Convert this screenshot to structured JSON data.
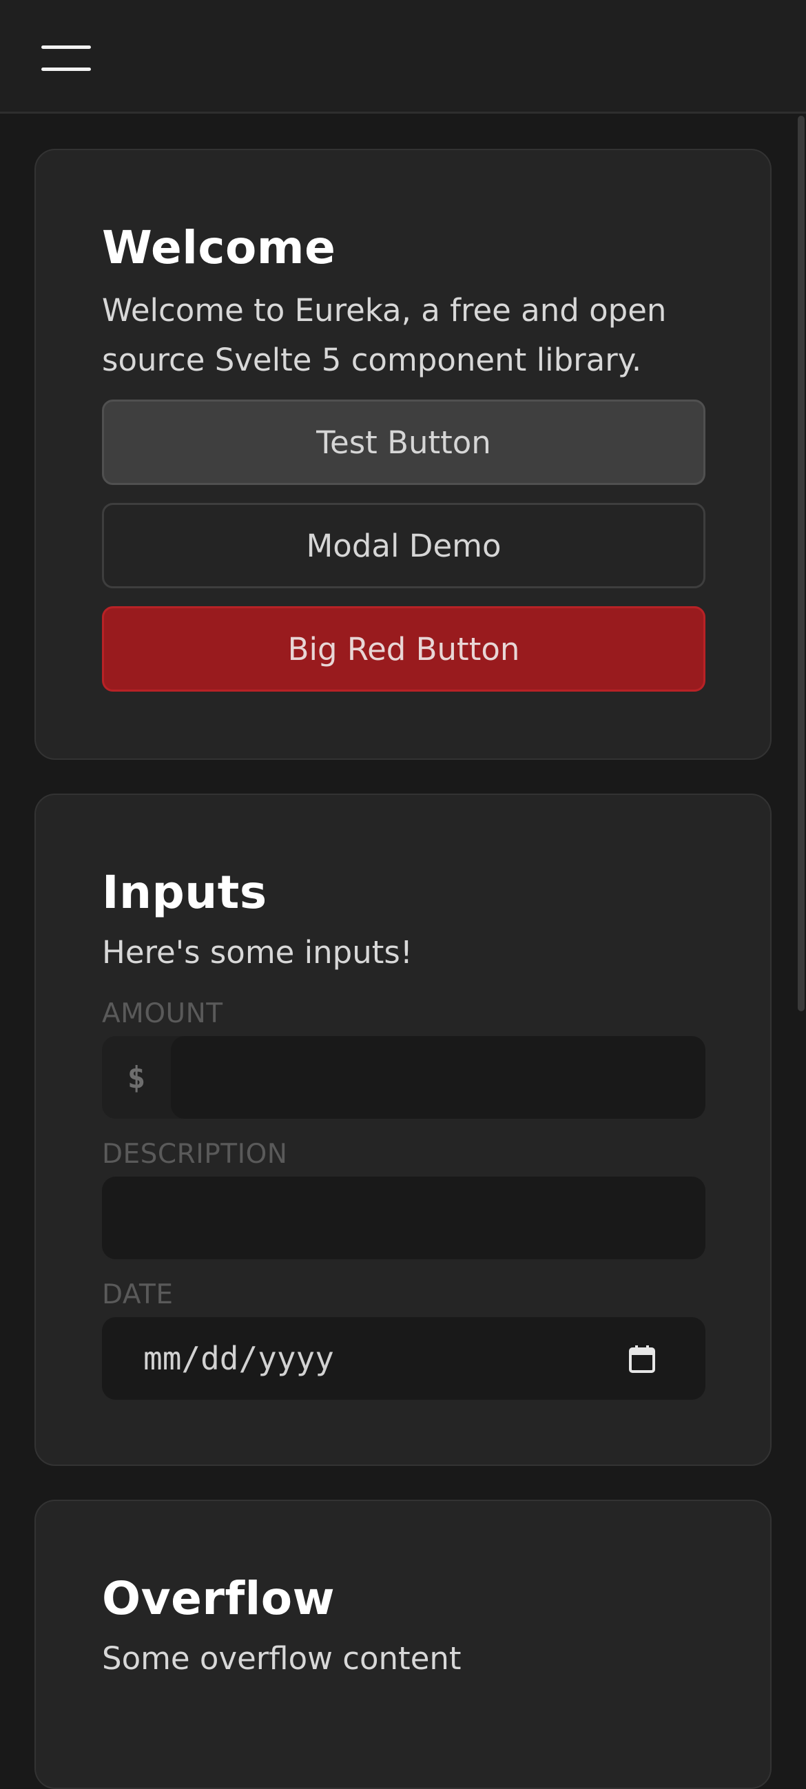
{
  "cards": {
    "welcome": {
      "title": "Welcome",
      "description": "Welcome to Eureka, a free and open source Svelte 5 component library.",
      "buttons": {
        "test": "Test Button",
        "modal": "Modal Demo",
        "red": "Big Red Button"
      }
    },
    "inputs": {
      "title": "Inputs",
      "description": "Here's some inputs!",
      "amount_label": "AMOUNT",
      "amount_prefix": "$",
      "amount_value": "",
      "description_label": "DESCRIPTION",
      "description_value": "",
      "date_label": "DATE",
      "date_placeholder": "mm/dd/yyyy"
    },
    "overflow": {
      "title": "Overflow",
      "description": "Some overflow content"
    }
  },
  "icons": {
    "menu": "hamburger-menu-icon",
    "calendar": "calendar-icon"
  },
  "colors": {
    "background": "#191919",
    "card": "#252525",
    "danger": "#991b1e"
  }
}
